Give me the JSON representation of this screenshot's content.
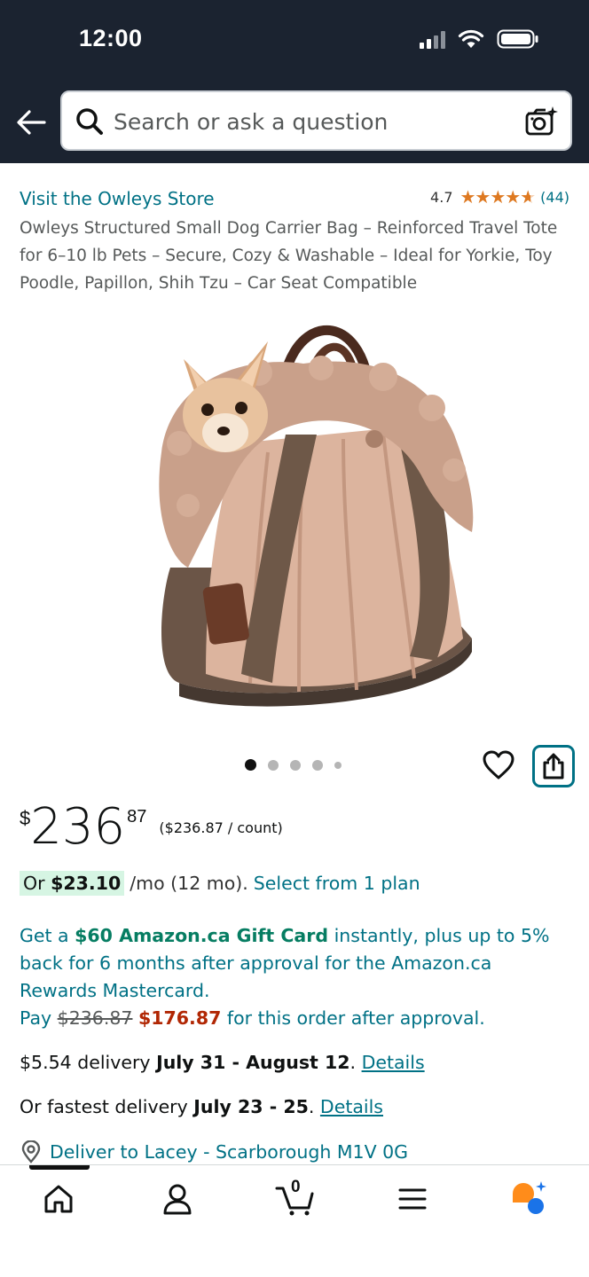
{
  "status_bar": {
    "time": "12:00"
  },
  "header": {
    "search_placeholder": "Search or ask a question"
  },
  "product": {
    "store_link": "Visit the Owleys Store",
    "rating_value": "4.7",
    "rating_stars": 4.7,
    "rating_count": "(44)",
    "title": "Owleys Structured Small Dog Carrier Bag – Reinforced Travel Tote for 6–10 lb Pets – Secure, Cozy & Washable – Ideal for Yorkie, Toy Poodle, Papillon, Shih Tzu – Car Seat Compatible",
    "image_count": 5,
    "image_active_index": 0
  },
  "price": {
    "symbol": "$",
    "whole": "236",
    "fraction": "87",
    "unit_price": "($236.87 / count)"
  },
  "installment": {
    "prefix": "Or",
    "amount": "$23.10",
    "terms": "/mo (12 mo).",
    "link": "Select from 1 plan"
  },
  "promo": {
    "get_a": "Get a",
    "gift_card": "$60 Amazon.ca Gift Card",
    "line_rest": "instantly, plus up to 5% back for 6 months after approval for the Amazon.ca Rewards Mastercard.",
    "pay": "Pay",
    "original_price": "$236.87",
    "new_price": "$176.87",
    "pay_rest": "for this order after approval."
  },
  "delivery": {
    "standard_price": "$5.54 delivery",
    "standard_dates": "July 31 - August 12",
    "details_label": "Details",
    "fastest_prefix": "Or fastest delivery",
    "fastest_dates": "July 23 - 25"
  },
  "deliver_to": "Deliver to Lacey - Scarborough M1V 0G",
  "bottom_nav": {
    "cart_count": "0"
  },
  "colors": {
    "header_bg": "#1b2330",
    "link": "#007185",
    "star": "#de7921",
    "green": "#067d62",
    "red": "#b12704",
    "installment_badge": "#d6f5e3"
  }
}
